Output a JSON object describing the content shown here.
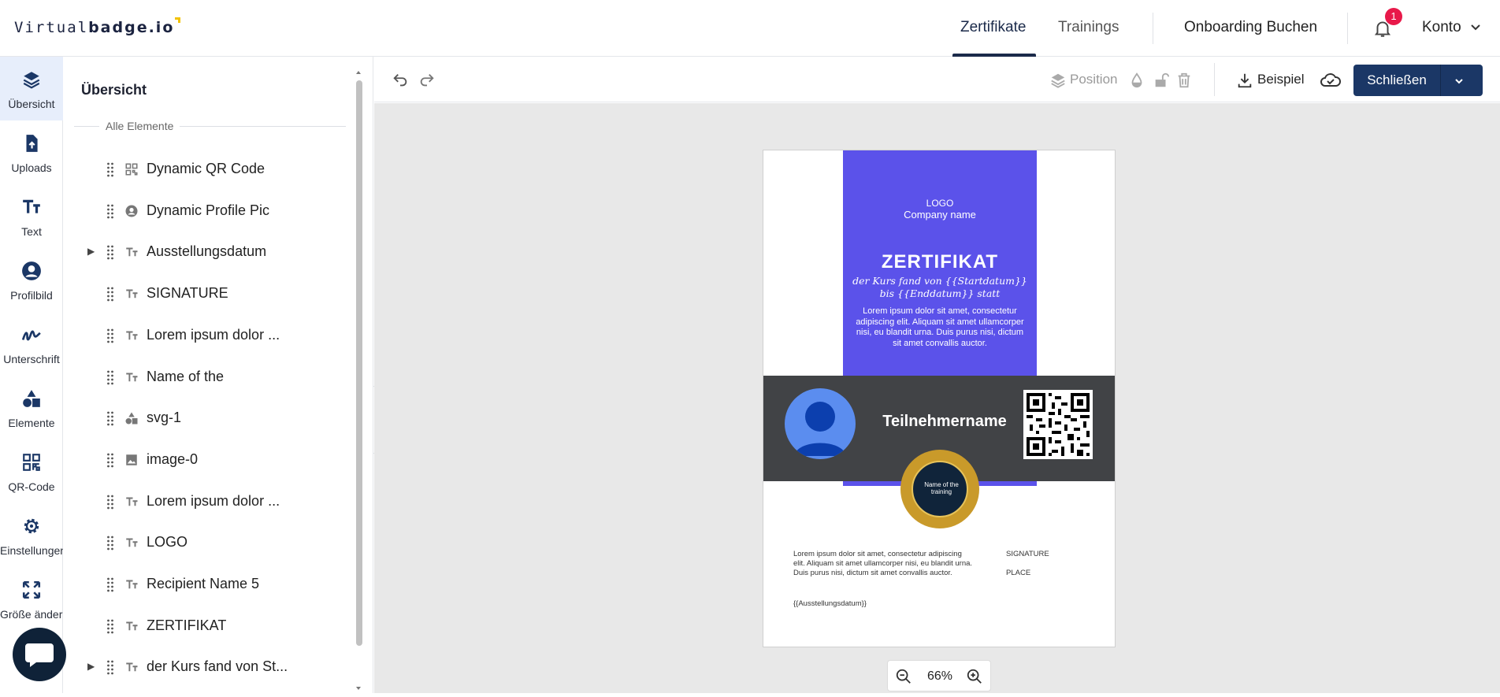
{
  "header": {
    "logo_light": "Virtual",
    "logo_bold": "badge.io",
    "nav": [
      "Zertifikate",
      "Trainings"
    ],
    "onboarding": "Onboarding Buchen",
    "notification_count": "1",
    "account": "Konto"
  },
  "rail": {
    "items": [
      "Übersicht",
      "Uploads",
      "Text",
      "Profilbild",
      "Unterschrift",
      "Elemente",
      "QR-Code",
      "Einstellungen",
      "Größe ändern"
    ]
  },
  "panel": {
    "title": "Übersicht",
    "section": "Alle Elemente",
    "layers": [
      {
        "name": "Dynamic QR Code",
        "icon": "qr-icon",
        "expandable": false
      },
      {
        "name": "Dynamic Profile Pic",
        "icon": "profile-icon",
        "expandable": false
      },
      {
        "name": "Ausstellungsdatum",
        "icon": "text-icon",
        "expandable": true
      },
      {
        "name": "SIGNATURE",
        "icon": "text-icon",
        "expandable": false
      },
      {
        "name": "Lorem ipsum dolor ...",
        "icon": "text-icon",
        "expandable": false
      },
      {
        "name": "Name of the",
        "icon": "text-icon",
        "expandable": false
      },
      {
        "name": "svg-1",
        "icon": "shapes-icon",
        "expandable": false
      },
      {
        "name": "image-0",
        "icon": "image-icon",
        "expandable": false
      },
      {
        "name": "Lorem ipsum dolor ...",
        "icon": "text-icon",
        "expandable": false
      },
      {
        "name": "LOGO",
        "icon": "text-icon",
        "expandable": false
      },
      {
        "name": "Recipient Name 5",
        "icon": "text-icon",
        "expandable": false
      },
      {
        "name": "ZERTIFIKAT",
        "icon": "text-icon",
        "expandable": false
      },
      {
        "name": "der Kurs fand von St...",
        "icon": "text-icon",
        "expandable": true
      }
    ]
  },
  "toolbar": {
    "position": "Position",
    "beispiel": "Beispiel",
    "close": "Schließen"
  },
  "certificate": {
    "logo": "LOGO",
    "company": "Company name",
    "title": "ZERTIFIKAT",
    "course_line1": "der Kurs fand von {{Startdatum}}",
    "course_line2": "bis {{Enddatum}} statt",
    "lorem_top": "Lorem ipsum dolor sit amet, consectetur adipiscing elit. Aliquam sit amet ullamcorper nisi, eu blandit urna. Duis purus nisi, dictum sit amet convallis auctor.",
    "participant": "Teilnehmername",
    "seal_text": "Name of the training",
    "lorem_bottom": "Lorem ipsum dolor sit amet, consectetur adipiscing elit. Aliquam sit amet ullamcorper nisi, eu blandit urna. Duis purus nisi, dictum sit amet convallis auctor.",
    "signature": "SIGNATURE",
    "place": "PLACE",
    "issue_date": "{{Ausstellungsdatum}}"
  },
  "zoom": {
    "value": "66%"
  },
  "colors": {
    "accent": "#1b3766",
    "cert_purple": "#5b52ea",
    "cert_dark": "#414346",
    "badge": "#e8194a"
  }
}
